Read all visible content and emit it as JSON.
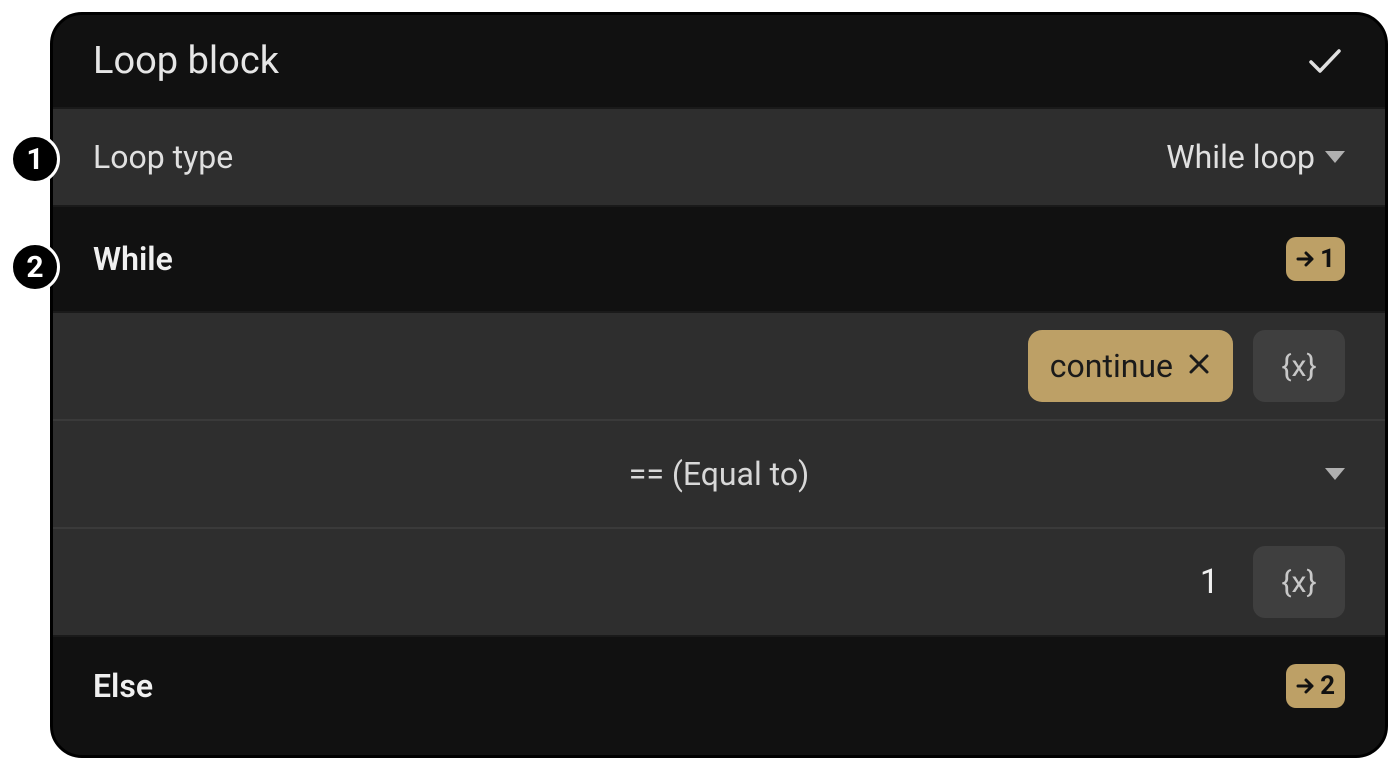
{
  "header": {
    "title": "Loop block"
  },
  "loop_type": {
    "label": "Loop type",
    "value": "While loop"
  },
  "while_section": {
    "label": "While",
    "goto_number": "1"
  },
  "condition": {
    "left_token": "continue",
    "operator": "== (Equal to)",
    "right_value": "1",
    "var_label": "{x}"
  },
  "else_section": {
    "label": "Else",
    "goto_number": "2"
  },
  "callouts": {
    "c1": "1",
    "c2": "2"
  }
}
